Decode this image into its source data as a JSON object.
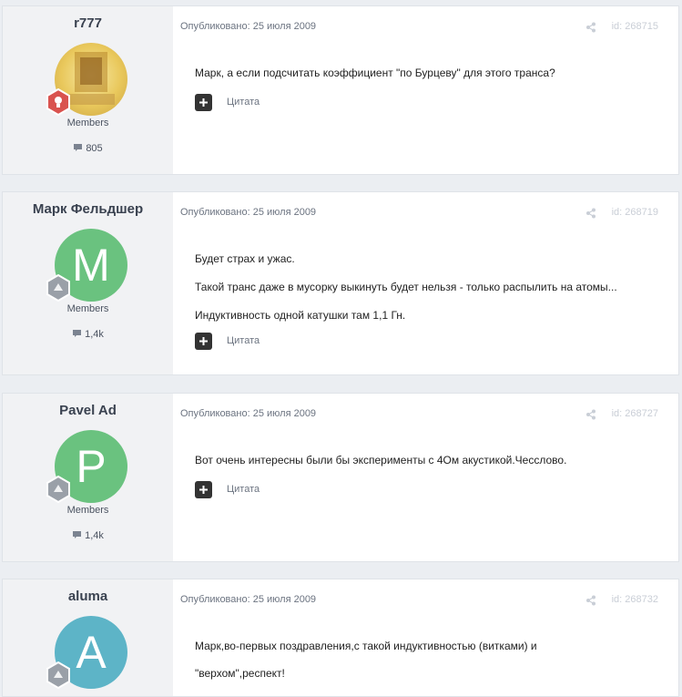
{
  "posts": [
    {
      "author": "r777",
      "group": "Members",
      "count": "805",
      "avatar_letter": "",
      "avatar_color": "",
      "badge": "red",
      "published": "Опубликовано: 25 июля 2009",
      "post_id": "id: 268715",
      "paragraphs": [
        "Марк, а если подсчитать коэффициент \"по Бурцеву\" для этого транса?"
      ],
      "quote_label": "Цитата"
    },
    {
      "author": "Марк Фельдшер",
      "group": "Members",
      "count": "1,4k",
      "avatar_letter": "M",
      "avatar_color": "#6ac27f",
      "badge": "gray",
      "published": "Опубликовано: 25 июля 2009",
      "post_id": "id: 268719",
      "paragraphs": [
        "Будет страх и ужас.",
        "Такой транс даже в мусорку выкинуть будет нельзя - только распылить на атомы...",
        "Индуктивность одной катушки там 1,1 Гн."
      ],
      "quote_label": "Цитата"
    },
    {
      "author": "Pavel Ad",
      "group": "Members",
      "count": "1,4k",
      "avatar_letter": "P",
      "avatar_color": "#6ac27f",
      "badge": "gray",
      "published": "Опубликовано: 25 июля 2009",
      "post_id": "id: 268727",
      "paragraphs": [
        "Вот очень интересны были бы эксперименты с 4Ом акустикой.Чесслово."
      ],
      "quote_label": "Цитата"
    },
    {
      "author": "aluma",
      "group": "",
      "count": "",
      "avatar_letter": "A",
      "avatar_color": "#5db4c7",
      "badge": "gray",
      "published": "Опубликовано: 25 июля 2009",
      "post_id": "id: 268732",
      "paragraphs": [
        "Марк,во-первых поздравления,с такой индуктивностью (витками) и",
        "\"верхом\",респект!"
      ],
      "quote_label": ""
    }
  ]
}
